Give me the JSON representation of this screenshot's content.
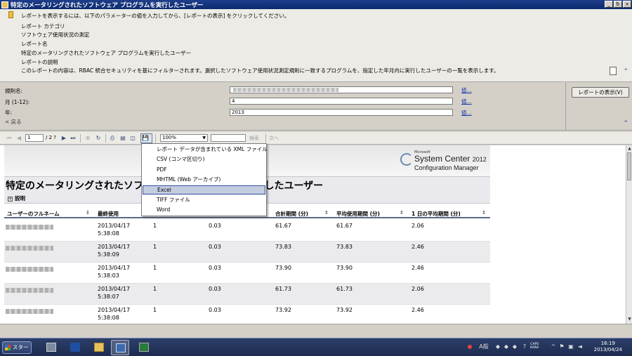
{
  "window": {
    "title": "特定のメータリングされたソフトウェア プログラムを実行したユーザー",
    "buttons": [
      "_",
      "ƀ",
      "×"
    ]
  },
  "description": {
    "instruction": "レポートを表示するには、以下のパラメーターの値を入力してから、[レポートの表示] をクリックしてください。",
    "category_label": "レポート カテゴリ",
    "category_value": "ソフトウェア使用状況の測定",
    "name_label": "レポート名",
    "name_value": "特定のメータリングされたソフトウェア プログラムを実行したユーザー",
    "desc_label": "レポートの説明",
    "desc_value": "このレポートの内容は、RBAC 統合セキュリティを基にフィルターされます。選択したソフトウェア使用状況測定規則に一致するプログラムを、指定した年月内に実行したユーザーの一覧を表示します。"
  },
  "params": {
    "rule_label": "規則名:",
    "month_label": "月 (1-12):",
    "month_value": "4",
    "year_label": "年:",
    "year_value": "2013",
    "value_link": "値...",
    "view_report_button": "レポートの表示(V)",
    "back_link": "< 戻る"
  },
  "toolbar": {
    "page_current": "1",
    "page_total": "/ 2 ?",
    "zoom": "100%",
    "find": "検索",
    "next": "次へ"
  },
  "export_menu": {
    "items": [
      "レポート データが含まれている XML ファイル",
      "CSV (コンマ区切り)",
      "PDF",
      "MHTML (Web アーカイブ)",
      "Excel",
      "TIFF ファイル",
      "Word"
    ],
    "selected": "Excel"
  },
  "report": {
    "logo": {
      "microsoft": "Microsoft",
      "product": "System Center",
      "version": "2012",
      "subtitle": "Configuration Manager"
    },
    "title": "特定のメータリングされたソフトウェア プログラムを実行したユーザー",
    "explain": "説明",
    "columns": [
      "ユーザーのフルネーム",
      "最終使用",
      "",
      "",
      "合計期間 (分)",
      "平均使用期間 (分)",
      "1 日の平均期間 (分)"
    ],
    "rows": [
      {
        "date": "2013/04/17",
        "time": "5:38:08",
        "c3": "1",
        "c4": "0.03",
        "c5": "61.67",
        "c6": "61.67",
        "c7": "2.06"
      },
      {
        "date": "2013/04/17",
        "time": "5:38:09",
        "c3": "1",
        "c4": "0.03",
        "c5": "73.83",
        "c6": "73.83",
        "c7": "2.46"
      },
      {
        "date": "2013/04/17",
        "time": "5:38:03",
        "c3": "1",
        "c4": "0.03",
        "c5": "73.90",
        "c6": "73.90",
        "c7": "2.46"
      },
      {
        "date": "2013/04/17",
        "time": "5:38:07",
        "c3": "1",
        "c4": "0.03",
        "c5": "61.73",
        "c6": "61.73",
        "c7": "2.06"
      },
      {
        "date": "2013/04/17",
        "time": "5:38:08",
        "c3": "1",
        "c4": "0.03",
        "c5": "73.92",
        "c6": "73.92",
        "c7": "2.46"
      }
    ]
  },
  "taskbar": {
    "start": "スタート",
    "caps": "CAPS",
    "kana": "KANA",
    "ime": "A般",
    "time": "16:19",
    "date": "2013/04/24"
  },
  "colors": {
    "titlebar": "#0b2a6e",
    "menu_selected": "#c4cde0",
    "taskbar": "#1d2b4f"
  }
}
